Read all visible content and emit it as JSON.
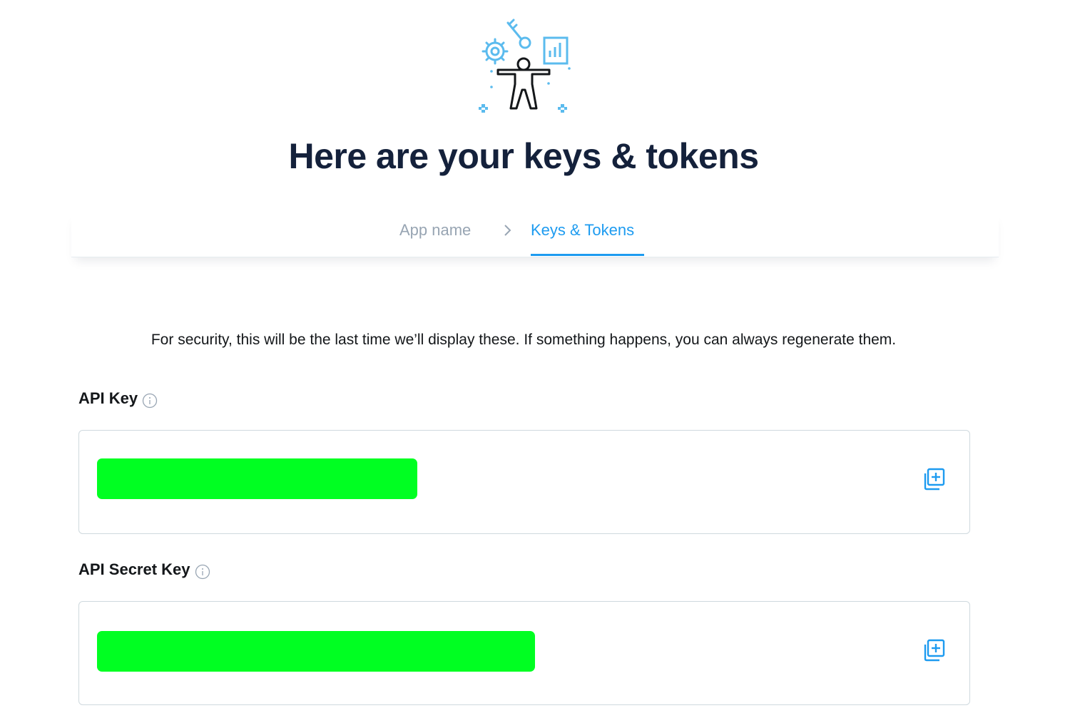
{
  "page": {
    "title": "Here are your keys & tokens"
  },
  "breadcrumb": {
    "app_name": "App name",
    "current": "Keys & Tokens",
    "separator_icon": "chevron-right-icon"
  },
  "notice": "For security, this will be the last time we’ll display these. If something happens, you can always regenerate them.",
  "api_key": {
    "label": "API Key",
    "value": "",
    "redaction_color": "#00ff22",
    "copy_icon": "copy-plus-icon",
    "info_icon": "info-icon"
  },
  "api_secret_key": {
    "label": "API Secret Key",
    "value": "",
    "redaction_color": "#00ff22",
    "copy_icon": "copy-plus-icon",
    "info_icon": "info-icon"
  },
  "colors": {
    "accent": "#1d9bf0",
    "illustration_accent": "#5bbbee",
    "title": "#14213b",
    "muted": "#98a5b3",
    "border": "#cfd9de"
  }
}
